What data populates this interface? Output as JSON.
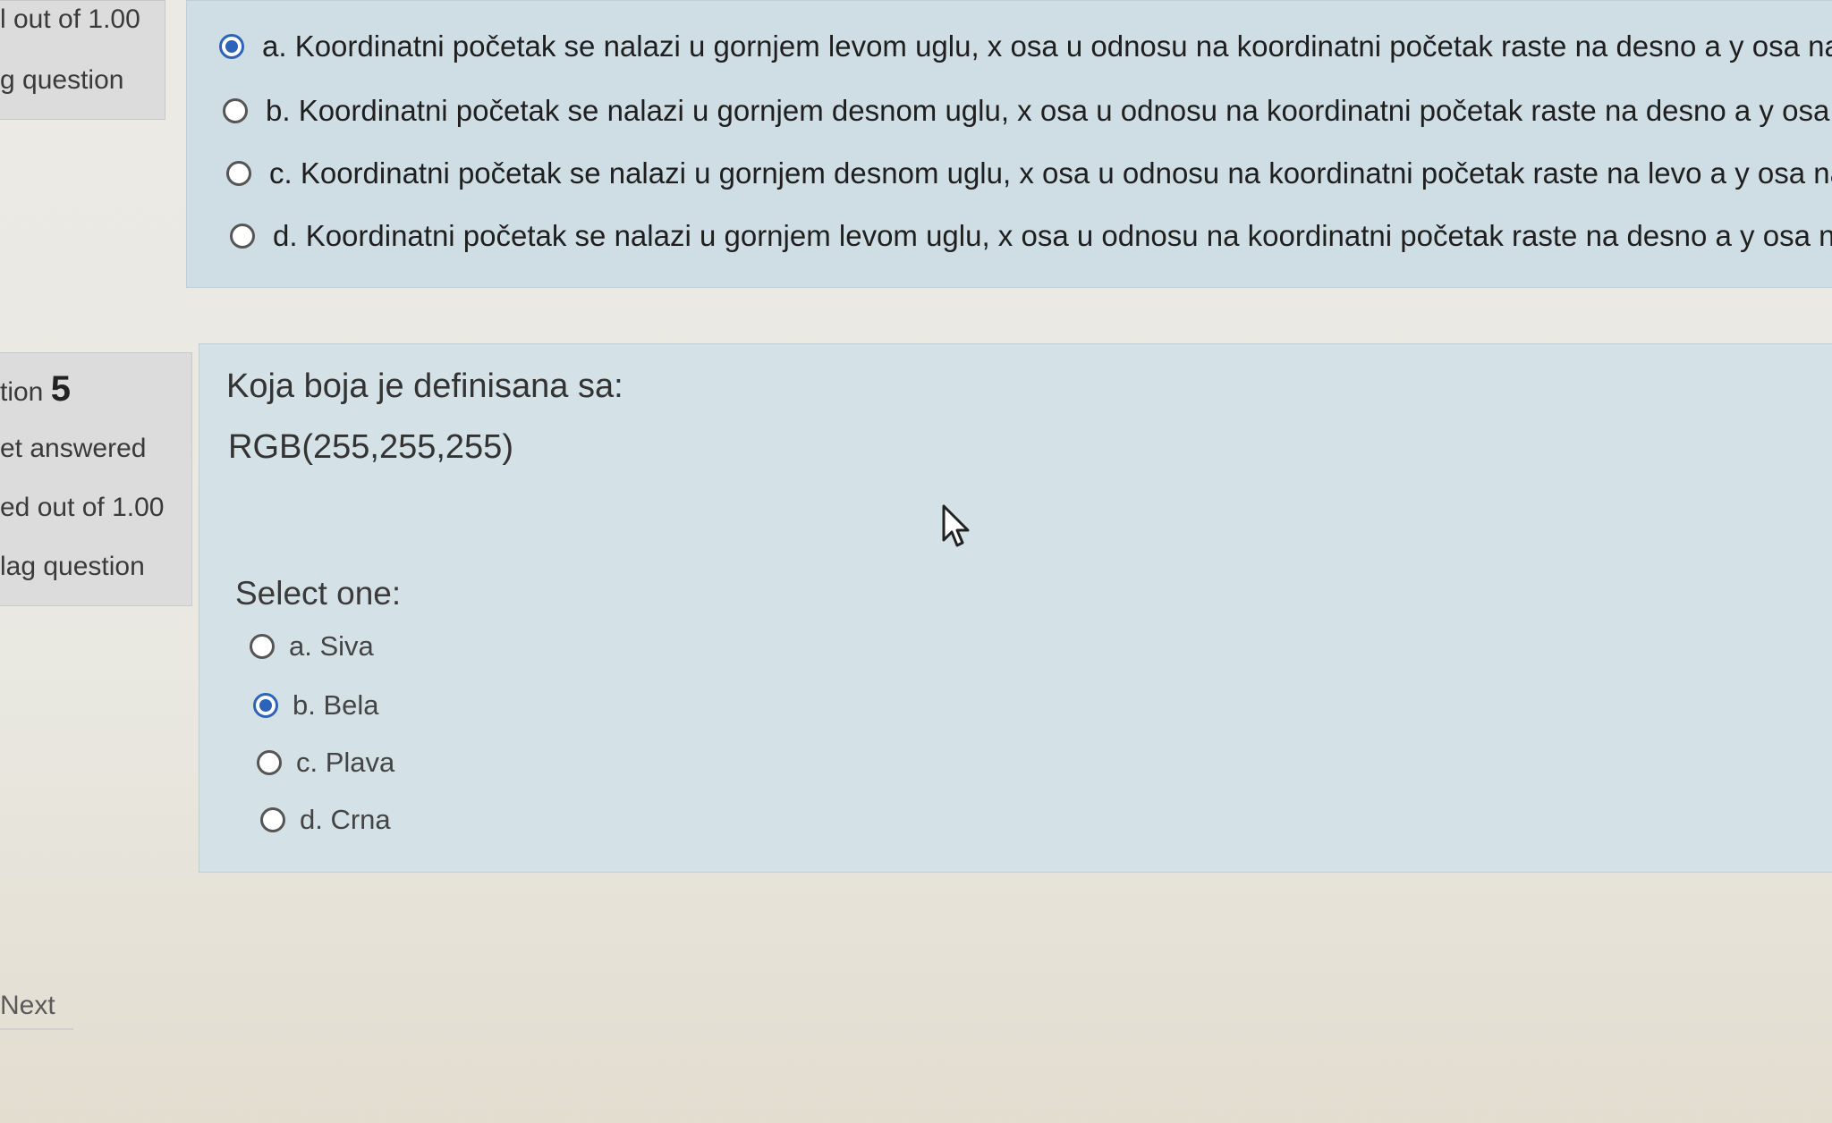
{
  "prev_question": {
    "info": {
      "marks": "l out of 1.00",
      "flag": "g question"
    },
    "options": [
      {
        "label": "a. Koordinatni početak se nalazi u gornjem levom uglu, x osa u odnosu na koordinatni početak raste na desno a y osa na d",
        "checked": true
      },
      {
        "label": "b. Koordinatni početak se nalazi u gornjem desnom uglu, x osa u odnosu na koordinatni početak raste na desno a y osa na",
        "checked": false
      },
      {
        "label": "c. Koordinatni početak se nalazi u gornjem desnom uglu, x osa u odnosu na koordinatni početak raste na levo a y osa na d",
        "checked": false
      },
      {
        "label": "d. Koordinatni početak se nalazi u gornjem levom uglu, x osa u odnosu na koordinatni početak raste na desno a y osa na g",
        "checked": false
      }
    ]
  },
  "question5": {
    "info": {
      "prefix": "tion",
      "number": "5",
      "status": "et answered",
      "marks": "ed out of 1.00",
      "flag": "lag question"
    },
    "text_line1": "Koja boja je definisana sa:",
    "text_line2": "RGB(255,255,255)",
    "select_one": "Select one:",
    "options": [
      {
        "label": "a. Siva",
        "checked": false
      },
      {
        "label": "b. Bela",
        "checked": true
      },
      {
        "label": "c. Plava",
        "checked": false
      },
      {
        "label": "d. Crna",
        "checked": false
      }
    ]
  },
  "navigation": {
    "next_label": "Next"
  },
  "colors": {
    "accent": "#2d63b8",
    "panel_bg": "#d4e1e6",
    "info_bg": "#dcdcdc"
  },
  "icons": {
    "cursor": "mouse-pointer-icon"
  }
}
